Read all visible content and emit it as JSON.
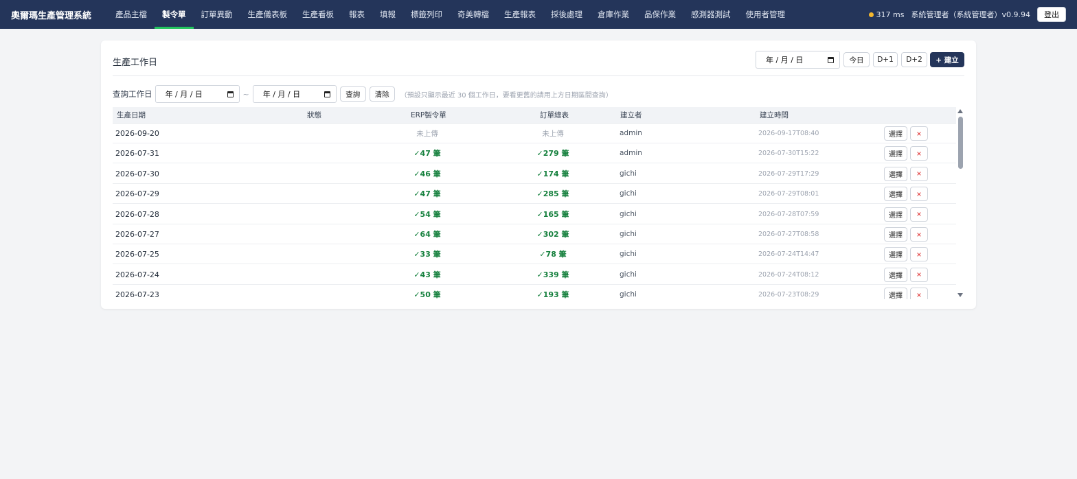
{
  "app": {
    "title": "奧爾瑪生產管理系統",
    "nav": [
      "產品主檔",
      "製令單",
      "訂單異動",
      "生產儀表板",
      "生產看板",
      "報表",
      "填報",
      "標籤列印",
      "奇美轉檔",
      "生產報表",
      "採後處理",
      "倉庫作業",
      "品保作業",
      "感測器測試",
      "使用者管理"
    ],
    "active_nav": 1,
    "latency": "317 ms",
    "latency_color": "#f5b82e",
    "user": "系統管理者（系統管理者）v0.9.94",
    "logout_label": "登出"
  },
  "card": {
    "title": "生產工作日",
    "date_placeholder": "年 / 月 / 日",
    "today_label": "今日",
    "d1_label": "D+1",
    "d2_label": "D+2",
    "create_label": "+ 建立"
  },
  "query": {
    "label": "查詢工作日",
    "tilde": "~",
    "search_label": "查詢",
    "clear_label": "清除",
    "hint": "（預設只顯示最近 30 個工作日，要看更舊的請用上方日期區間查詢）"
  },
  "table": {
    "headers": [
      "生產日期",
      "狀態",
      "ERP製令單",
      "訂單總表",
      "建立者",
      "建立時間"
    ],
    "select_label": "選擇",
    "delete_label": "×",
    "rows": [
      {
        "date": "2026-09-20",
        "erp": "未上傳",
        "erp_ok": false,
        "summary": "未上傳",
        "summary_ok": false,
        "creator": "admin",
        "time": "2026-09-17T08:40"
      },
      {
        "date": "2026-07-31",
        "erp": "✓47 筆",
        "erp_ok": true,
        "summary": "✓279 筆",
        "summary_ok": true,
        "creator": "admin",
        "time": "2026-07-30T15:22"
      },
      {
        "date": "2026-07-30",
        "erp": "✓46 筆",
        "erp_ok": true,
        "summary": "✓174 筆",
        "summary_ok": true,
        "creator": "gichi",
        "time": "2026-07-29T17:29"
      },
      {
        "date": "2026-07-29",
        "erp": "✓47 筆",
        "erp_ok": true,
        "summary": "✓285 筆",
        "summary_ok": true,
        "creator": "gichi",
        "time": "2026-07-29T08:01"
      },
      {
        "date": "2026-07-28",
        "erp": "✓54 筆",
        "erp_ok": true,
        "summary": "✓165 筆",
        "summary_ok": true,
        "creator": "gichi",
        "time": "2026-07-28T07:59"
      },
      {
        "date": "2026-07-27",
        "erp": "✓64 筆",
        "erp_ok": true,
        "summary": "✓302 筆",
        "summary_ok": true,
        "creator": "gichi",
        "time": "2026-07-27T08:58"
      },
      {
        "date": "2026-07-25",
        "erp": "✓33 筆",
        "erp_ok": true,
        "summary": "✓78 筆",
        "summary_ok": true,
        "creator": "gichi",
        "time": "2026-07-24T14:47"
      },
      {
        "date": "2026-07-24",
        "erp": "✓43 筆",
        "erp_ok": true,
        "summary": "✓339 筆",
        "summary_ok": true,
        "creator": "gichi",
        "time": "2026-07-24T08:12"
      },
      {
        "date": "2026-07-23",
        "erp": "✓50 筆",
        "erp_ok": true,
        "summary": "✓193 筆",
        "summary_ok": true,
        "creator": "gichi",
        "time": "2026-07-23T08:29"
      }
    ]
  }
}
